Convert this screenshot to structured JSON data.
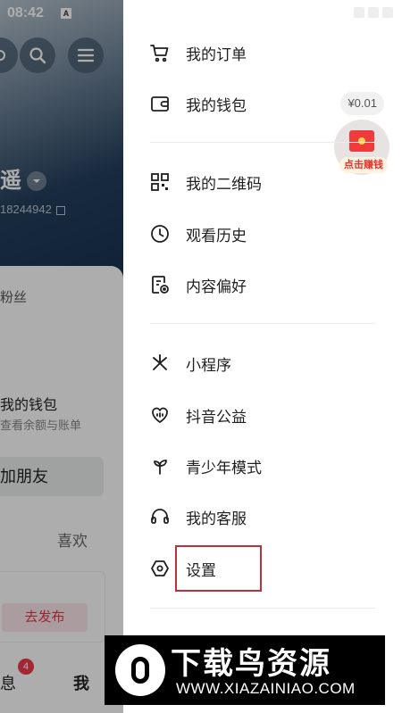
{
  "status_bar": {
    "time": "08:42",
    "notification_glyph": "A"
  },
  "background": {
    "name_fragment": "遥",
    "id_fragment": "18244942",
    "fans_label": "粉丝",
    "wallet_title": "我的钱包",
    "wallet_sub": "查看余额与账单",
    "add_friend": "加朋友",
    "likes_tab": "喜欢",
    "publish_button": "去发布",
    "nav_messages": "息",
    "messages_badge": "4",
    "nav_me": "我"
  },
  "drawer": {
    "group1": [
      {
        "label": "我的订单",
        "icon": "cart-icon"
      },
      {
        "label": "我的钱包",
        "icon": "wallet-icon",
        "chip": "¥0.01"
      }
    ],
    "redpacket_label": "点击赚钱",
    "group2": [
      {
        "label": "我的二维码",
        "icon": "qrcode-icon"
      },
      {
        "label": "观看历史",
        "icon": "clock-icon"
      },
      {
        "label": "内容偏好",
        "icon": "preference-icon"
      }
    ],
    "group3": [
      {
        "label": "小程序",
        "icon": "mini-program-icon"
      },
      {
        "label": "抖音公益",
        "icon": "charity-icon"
      },
      {
        "label": "青少年模式",
        "icon": "sprout-icon"
      },
      {
        "label": "我的客服",
        "icon": "headset-icon"
      },
      {
        "label": "设置",
        "icon": "settings-icon"
      }
    ]
  },
  "watermark": {
    "title": "下载鸟资源",
    "url": "WWW.XIAZAINIAO.COM"
  },
  "colors": {
    "accent_red": "#e0394b",
    "highlight_box": "#b8323e"
  }
}
